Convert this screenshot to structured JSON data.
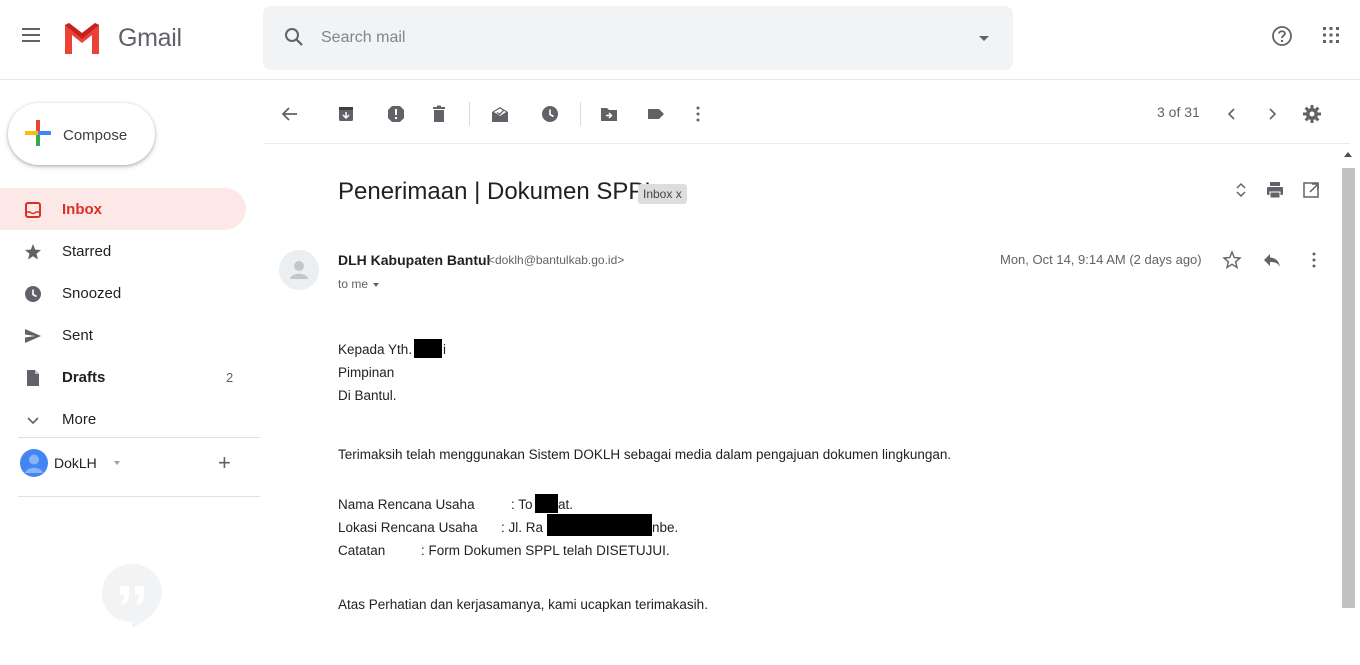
{
  "app": {
    "name": "Gmail"
  },
  "search": {
    "placeholder": "Search mail"
  },
  "compose": {
    "label": "Compose"
  },
  "sidebar": {
    "items": [
      {
        "label": "Inbox",
        "count": "",
        "icon": "inbox-icon"
      },
      {
        "label": "Starred",
        "count": "",
        "icon": "star-icon"
      },
      {
        "label": "Snoozed",
        "count": "",
        "icon": "clock-icon"
      },
      {
        "label": "Sent",
        "count": "",
        "icon": "send-icon"
      },
      {
        "label": "Drafts",
        "count": "2",
        "icon": "draft-icon"
      },
      {
        "label": "More",
        "count": "",
        "icon": "chevron-down-icon"
      }
    ],
    "account": {
      "name": "DokLH",
      "add": "+"
    }
  },
  "toolbar": {
    "pager": "3 of 31"
  },
  "email": {
    "subject": "Penerimaan | Dokumen SPPL",
    "label": "Inbox x",
    "sender_name": "DLH Kabupaten Bantul",
    "sender_email": "<doklh@bantulkab.go.id>",
    "recipient": "to me",
    "date": "Mon, Oct 14, 9:14 AM (2 days ago)",
    "body": {
      "line1": "Kepada Yth.",
      "line1_tail": "i",
      "line2": "Pimpinan",
      "line3": "Di Bantul.",
      "paragraph1": "Terimaksih telah menggunakan Sistem DOKLH sebagai media dalam pengajuan dokumen lingkungan.",
      "field1_label": "Nama Rencana Usaha",
      "field1_value_start": ": To",
      "field1_value_end": "at.",
      "field2_label": "Lokasi Rencana Usaha",
      "field2_value_start": ": Jl. Ra",
      "field2_value_end": "nbe.",
      "field3_label": "Catatan",
      "field3_value": ": Form Dokumen SPPL telah DISETUJUI.",
      "closing": "Atas Perhatian dan kerjasamanya, kami ucapkan terimakasih."
    }
  },
  "colors": {
    "accent_red": "#d93025",
    "active_bg": "#fce8e6",
    "icon_gray": "#5f6368",
    "search_bg": "#f1f3f4"
  }
}
